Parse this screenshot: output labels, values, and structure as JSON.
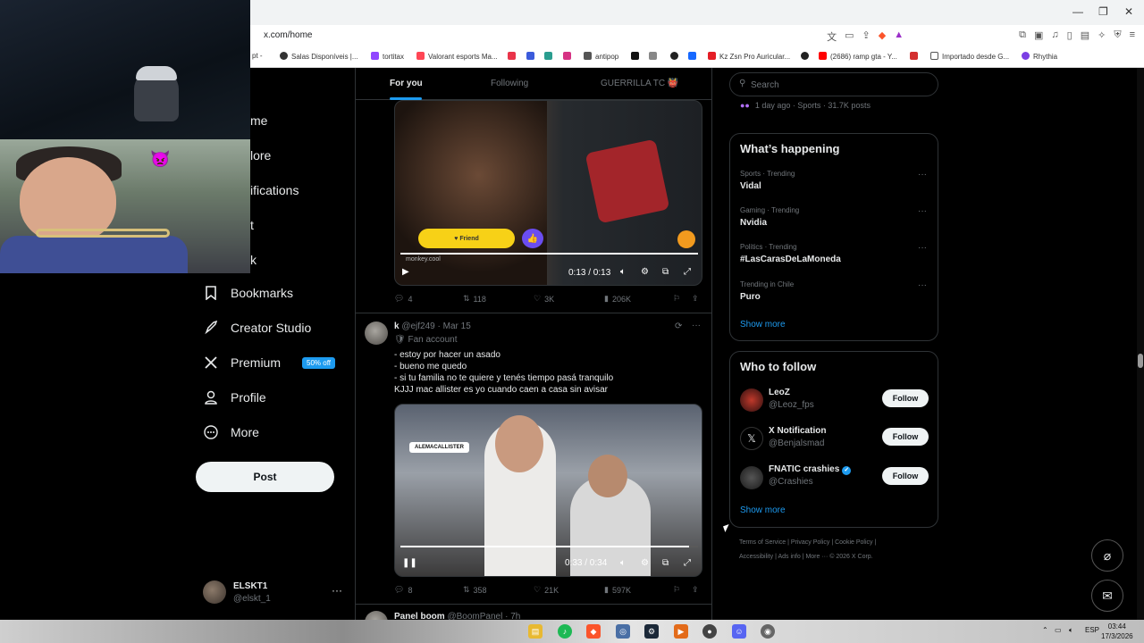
{
  "browser": {
    "url": "x.com/home",
    "bookmarks": [
      "pt -",
      "Salas Disponíveis |...",
      "tortitax",
      "Valorant esports Ma...",
      "antipop",
      "Kz Zsn Pro Auricular...",
      "(2686) ramp gta - Y...",
      "Importado desde G...",
      "Rhythia"
    ]
  },
  "nav": {
    "partials": [
      "me",
      "lore",
      "ifications",
      "t",
      "k"
    ],
    "items": [
      "Bookmarks",
      "Creator Studio",
      "Premium",
      "Profile",
      "More"
    ],
    "premium_badge": "50% off",
    "post_label": "Post",
    "account": {
      "name": "ELSKT1",
      "handle": "@elskt_1",
      "more": "···"
    }
  },
  "tabs": [
    "For you",
    "Following",
    "GUERRILLA TC 👹"
  ],
  "tweet1": {
    "friend_label": "Friend",
    "watermark": "monkey.cool",
    "time": "0:13 / 0:13",
    "progress": 1.0,
    "stats": {
      "replies": "4",
      "reposts": "118",
      "likes": "3K",
      "views": "206K"
    }
  },
  "tweet2": {
    "name": "k",
    "handle": "@ejf249",
    "date": "· Mar 15",
    "label": "Fan account",
    "lines": [
      "- estoy por hacer un asado",
      "- bueno me quedo",
      "- si tu familia no te quiere y tenés tiempo pasá tranquilo",
      "KJJJ mac allister es yo cuando caen a casa sin avisar"
    ],
    "video_tag": "ALEMACALLISTER",
    "time": "0:33 / 0:34",
    "progress": 0.97,
    "stats": {
      "replies": "8",
      "reposts": "358",
      "likes": "21K",
      "views": "597K"
    }
  },
  "tweet3": {
    "name": "Panel boom",
    "handle": "@BoomPanel",
    "date": "· 7h"
  },
  "right": {
    "search_placeholder": "Search",
    "top_trend_meta": "1 day ago · Sports · 31.7K posts",
    "happening_title": "What’s happening",
    "trends": [
      {
        "meta": "Sports · Trending",
        "name": "Vidal"
      },
      {
        "meta": "Gaming · Trending",
        "name": "Nvidia"
      },
      {
        "meta": "Politics · Trending",
        "name": "#LasCarasDeLaMoneda"
      },
      {
        "meta": "Trending in Chile",
        "name": "Puro"
      }
    ],
    "show_more": "Show more",
    "wtf_title": "Who to follow",
    "follow_label": "Follow",
    "suggestions": [
      {
        "name": "LeoZ",
        "handle": "@Leoz_fps"
      },
      {
        "name": "X Notification",
        "handle": "@Benjalsmad"
      },
      {
        "name": "FNATIC crashies",
        "handle": "@Crashies"
      }
    ],
    "footer_line1": "Terms of Service  |  Privacy Policy  |  Cookie Policy  |",
    "footer_line2": "Accessibility  |  Ads info  |  More ···  © 2026 X Corp."
  },
  "taskbar": {
    "lang": "ESP",
    "time": "03:44",
    "date": "17/3/2026"
  },
  "colors": {
    "accent": "#1d9bf0",
    "bg": "#000000",
    "border": "#2f3336",
    "muted": "#71767b"
  }
}
